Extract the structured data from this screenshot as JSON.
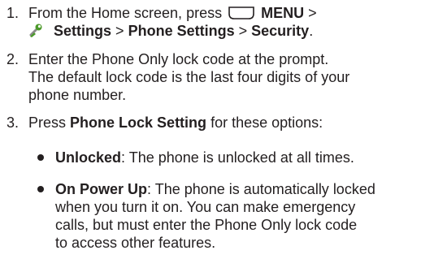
{
  "steps": [
    {
      "number": "1.",
      "pre": "From the Home screen, press",
      "menu_key_icon": "menu-key-icon",
      "menu_label": "MENU",
      "sep1": ">",
      "settings_icon": "settings-wrench-icon",
      "path": [
        "Settings",
        "Phone Settings",
        "Security"
      ],
      "sep": ">",
      "end": "."
    },
    {
      "number": "2.",
      "line1": "Enter the Phone Only lock code at the prompt.",
      "line2": "The default lock code is the last four digits of your",
      "line3": "phone number."
    },
    {
      "number": "3.",
      "pre": "Press",
      "bold": "Phone Lock Setting",
      "post": "for these options:"
    }
  ],
  "options": [
    {
      "label": "Unlocked",
      "desc": ": The phone is unlocked at all times."
    },
    {
      "label": "On Power Up",
      "desc_line1": ": The phone is automatically locked",
      "desc_line2": "when you turn it on. You can make emergency",
      "desc_line3": "calls, but must enter the Phone Only lock code",
      "desc_line4": "to access other features."
    }
  ],
  "colors": {
    "text": "#231f20",
    "icon_green": "#4c9a2a",
    "icon_gray": "#8a8a8a"
  }
}
